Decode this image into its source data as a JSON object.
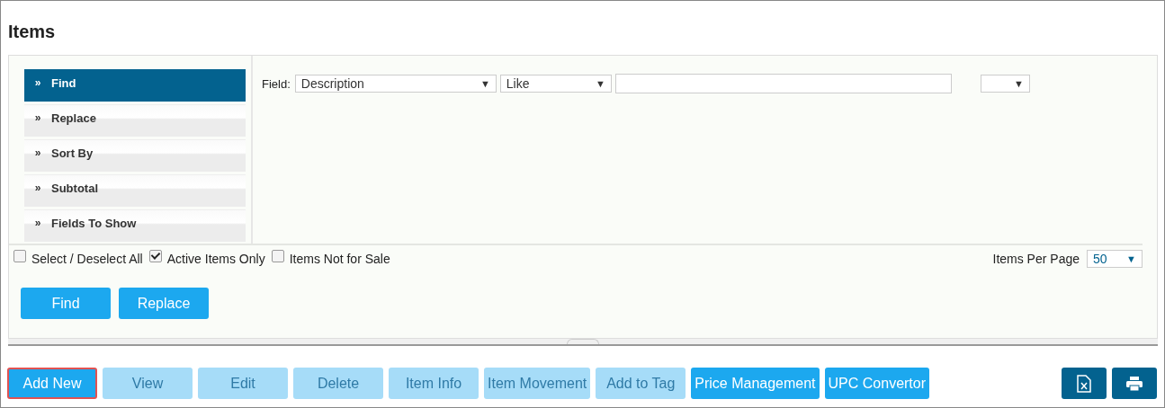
{
  "page_title": "Items",
  "menu": [
    {
      "marker": "»",
      "label": "Find",
      "selected": true
    },
    {
      "marker": "»",
      "label": "Replace",
      "selected": false
    },
    {
      "marker": "»",
      "label": "Sort By",
      "selected": false
    },
    {
      "marker": "»",
      "label": "Subtotal",
      "selected": false
    },
    {
      "marker": "»",
      "label": "Fields To Show",
      "selected": false
    }
  ],
  "criteria": {
    "label": "Field:",
    "field": "Description",
    "operator": "Like",
    "extra_arrow": "▼",
    "arrow": "▼"
  },
  "options": [
    {
      "label": "Select / Deselect All",
      "checked": false
    },
    {
      "label": "Active Items Only",
      "checked": true
    },
    {
      "label": "Items Not for Sale",
      "checked": false
    }
  ],
  "per_page": {
    "label": "Items Per Page",
    "value": "50",
    "arrow": "▼"
  },
  "panel_buttons": [
    "Find",
    "Replace"
  ],
  "toolbar": [
    {
      "label": "Add New",
      "disabled": false,
      "focused": true
    },
    {
      "label": "View",
      "disabled": true,
      "focused": false
    },
    {
      "label": "Edit",
      "disabled": true,
      "focused": false
    },
    {
      "label": "Delete",
      "disabled": true,
      "focused": false
    },
    {
      "label": "Item Info",
      "disabled": true,
      "focused": false
    },
    {
      "label": "Item Movement",
      "disabled": true,
      "focused": false
    },
    {
      "label": "Add to Tag",
      "disabled": true,
      "focused": false
    },
    {
      "label": "Price Management",
      "disabled": false,
      "focused": false
    },
    {
      "label": "UPC Convertor",
      "disabled": false,
      "focused": false
    }
  ]
}
